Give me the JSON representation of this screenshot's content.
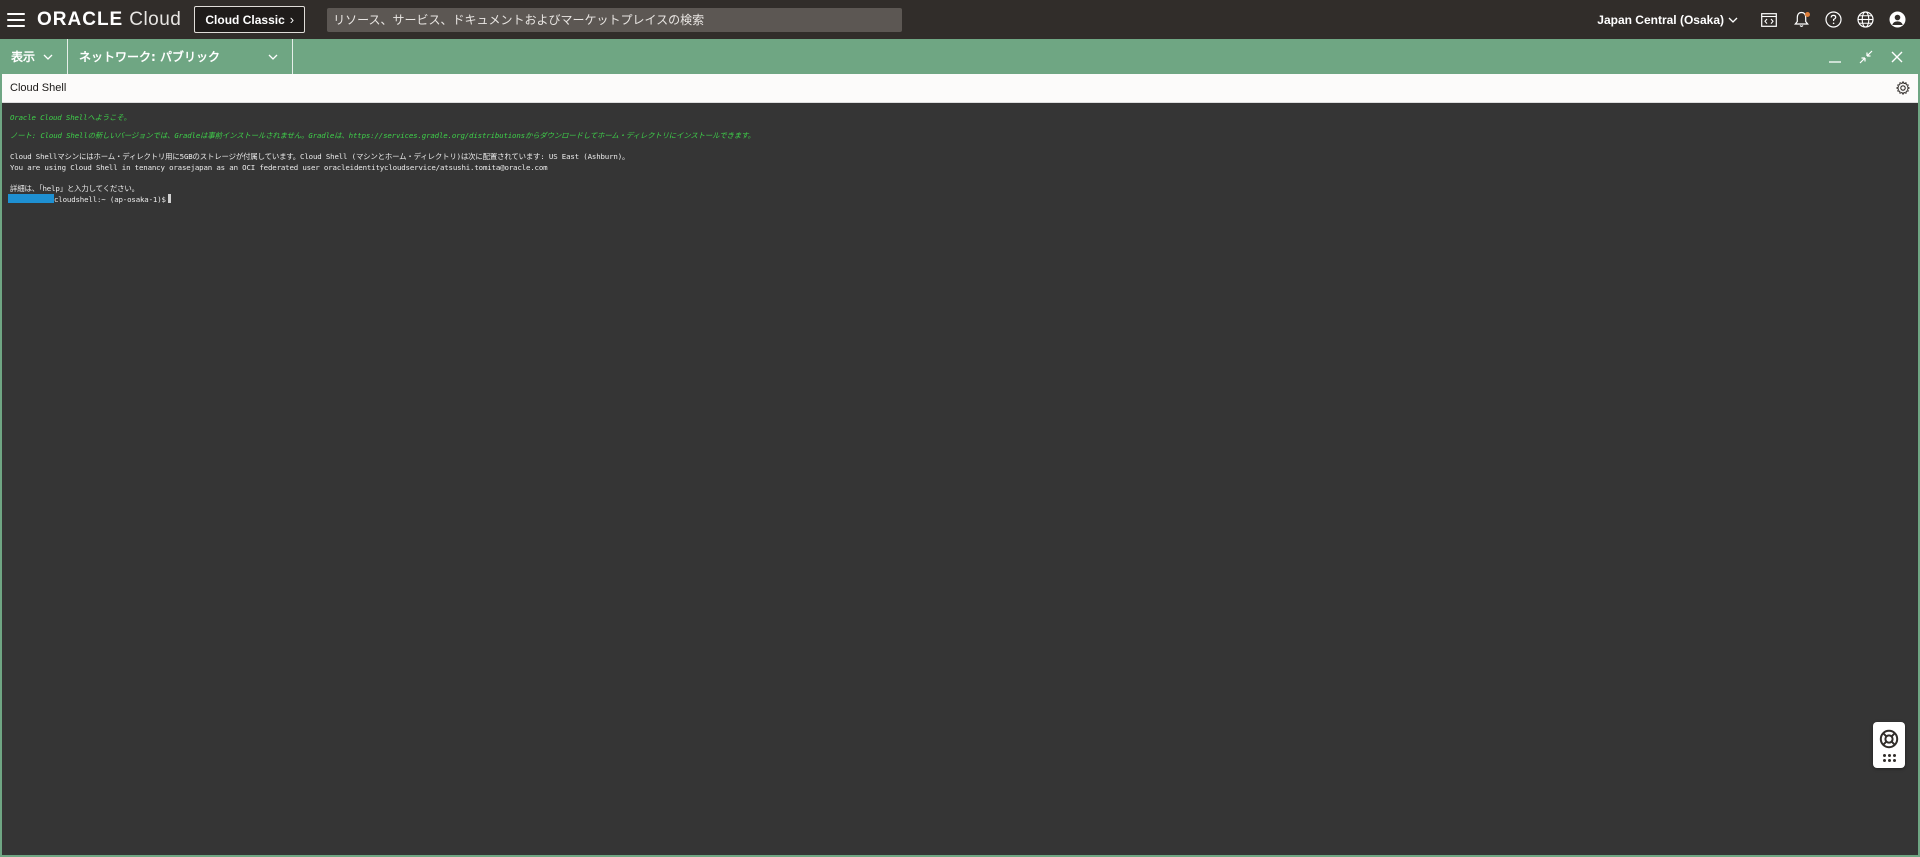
{
  "header": {
    "logo_brand": "ORACLE",
    "logo_product": "Cloud",
    "classic_button": "Cloud Classic",
    "search_placeholder": "リソース、サービス、ドキュメントおよびマーケットプレイスの検索",
    "region": "Japan Central (Osaka)",
    "icons": [
      "menu-icon",
      "code-editor-icon",
      "bell-icon",
      "help-icon",
      "globe-icon",
      "user-icon"
    ]
  },
  "toolbar": {
    "view_label": "表示",
    "network_label": "ネットワーク: パブリック",
    "controls": [
      "minimize-icon",
      "restore-icon",
      "close-icon"
    ]
  },
  "cloud_shell": {
    "title": "Cloud Shell",
    "terminal": {
      "welcome": "Oracle Cloud Shellへようこそ。",
      "note": "ノート: Cloud Shellの新しいバージョンでは、Gradleは事前インストールされません。Gradleは、https://services.gradle.org/distributionsからダウンロードしてホーム・ディレクトリにインストールできます。",
      "storage_info": "Cloud Shellマシンにはホーム・ディレクトリ用に5GBのストレージが付属しています。Cloud Shell (マシンとホーム・ディレクトリ)は次に配置されています: US East (Ashburn)。",
      "tenancy_info": "You are using Cloud Shell in tenancy orasejapan as an OCI federated user oracleidentitycloudservice/atsushi.tomita@oracle.com",
      "help_hint": "詳細は、「help」と入力してください。",
      "prompt": "cloudshell:~ (ap-osaka-1)$"
    }
  },
  "colors": {
    "header_bg": "#312d2a",
    "toolbar_green": "#6fa683",
    "terminal_bg": "#353535",
    "terminal_green": "#3ed14a",
    "masked_user": "#1e90d2"
  }
}
